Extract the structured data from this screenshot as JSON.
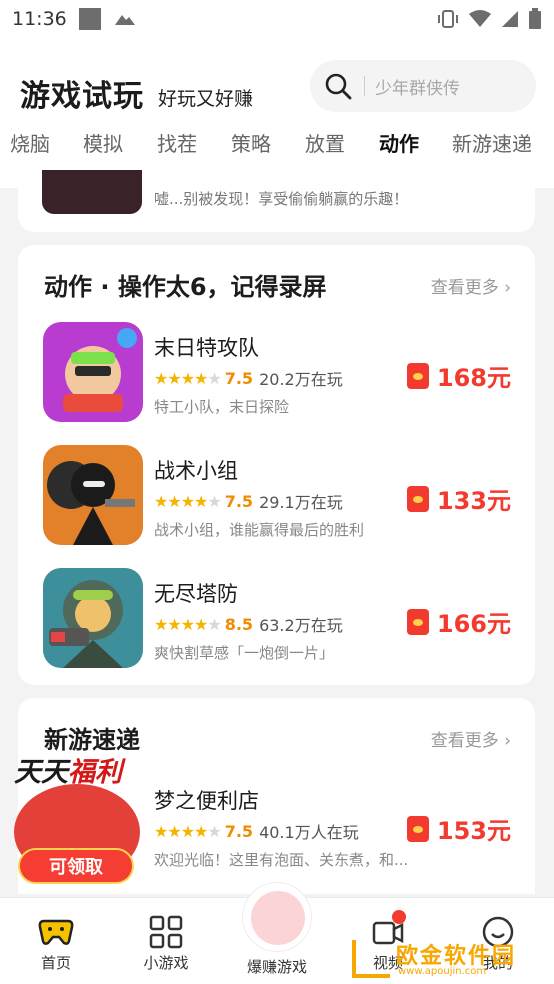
{
  "status": {
    "time": "11:36"
  },
  "header": {
    "brand": "游戏试玩",
    "slogan": "好玩又好赚",
    "search_placeholder": "少年群侠传"
  },
  "tabs": [
    "烧脑",
    "模拟",
    "找茬",
    "策略",
    "放置",
    "动作",
    "新游速递"
  ],
  "active_tab": "动作",
  "prev_card": {
    "desc": "嘘...别被发现！享受偷偷躺赢的乐趣！"
  },
  "action_section": {
    "title": "动作 · 操作太6，记得录屏",
    "more": "查看更多",
    "games": [
      {
        "name": "末日特攻队",
        "score": "7.5",
        "players": "20.2万在玩",
        "desc": "特工小队，末日探险",
        "reward": "168元",
        "rating": 3.5
      },
      {
        "name": "战术小组",
        "score": "7.5",
        "players": "29.1万在玩",
        "desc": "战术小组，谁能赢得最后的胜利",
        "reward": "133元",
        "rating": 3.5
      },
      {
        "name": "无尽塔防",
        "score": "8.5",
        "players": "63.2万在玩",
        "desc": "爽快割草感「一炮倒一片」",
        "reward": "166元",
        "rating": 4
      }
    ]
  },
  "new_section": {
    "title": "新游速递",
    "more": "查看更多",
    "games": [
      {
        "name": "梦之便利店",
        "score": "7.5",
        "players": "40.1万人在玩",
        "desc": "欢迎光临！这里有泡面、关东煮，和...",
        "reward": "153元",
        "rating": 3.5
      }
    ]
  },
  "floater": {
    "title_a": "天天",
    "title_b": "福利",
    "button": "可领取"
  },
  "nav": {
    "home": "首页",
    "mini": "小游戏",
    "earn": "爆赚游戏",
    "video": "视频",
    "mine": "我的"
  },
  "watermark": {
    "text": "欧金软件园",
    "sub": "www.apoujin.com"
  },
  "colors": {
    "accent_yellow": "#f5c100",
    "reward_red": "#f23b2e",
    "score_orange": "#f08c00"
  }
}
